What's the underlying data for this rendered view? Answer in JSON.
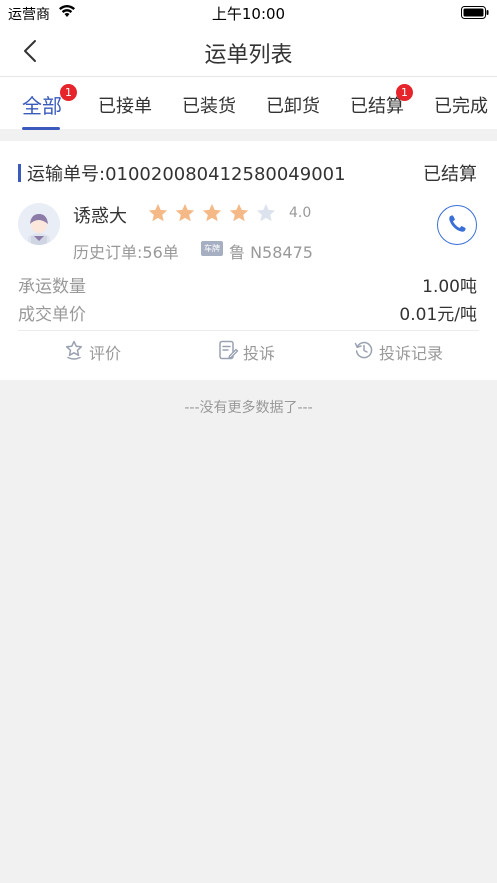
{
  "status_bar": {
    "carrier": "运营商",
    "time": "上午10:00"
  },
  "header": {
    "title": "运单列表"
  },
  "tabs": [
    {
      "label": "全部",
      "active": true,
      "badge": "1"
    },
    {
      "label": "已接单",
      "active": false,
      "badge": ""
    },
    {
      "label": "已装货",
      "active": false,
      "badge": ""
    },
    {
      "label": "已卸货",
      "active": false,
      "badge": ""
    },
    {
      "label": "已结算",
      "active": false,
      "badge": "1"
    },
    {
      "label": "已完成",
      "active": false,
      "badge": ""
    }
  ],
  "order": {
    "waybill_no": "运输单号:010020080412580049001",
    "status": "已结算",
    "driver_name": "诱惑大",
    "rating": 4.0,
    "rating_text": "4.0",
    "stars_total": 5,
    "history_orders": "历史订单:56单",
    "plate_icon_label": "车牌",
    "plate": "鲁 N58475",
    "quantity_label": "承运数量",
    "quantity_value": "1.00吨",
    "price_label": "成交单价",
    "price_value": "0.01元/吨",
    "actions": {
      "review": "评价",
      "complain": "投诉",
      "complaint_history": "投诉记录"
    }
  },
  "footer": {
    "no_more": "---没有更多数据了---"
  },
  "colors": {
    "accent": "#3a5bbd",
    "badge": "#e6242b",
    "star_on": "#f5b987",
    "star_off": "#dde3ee"
  }
}
